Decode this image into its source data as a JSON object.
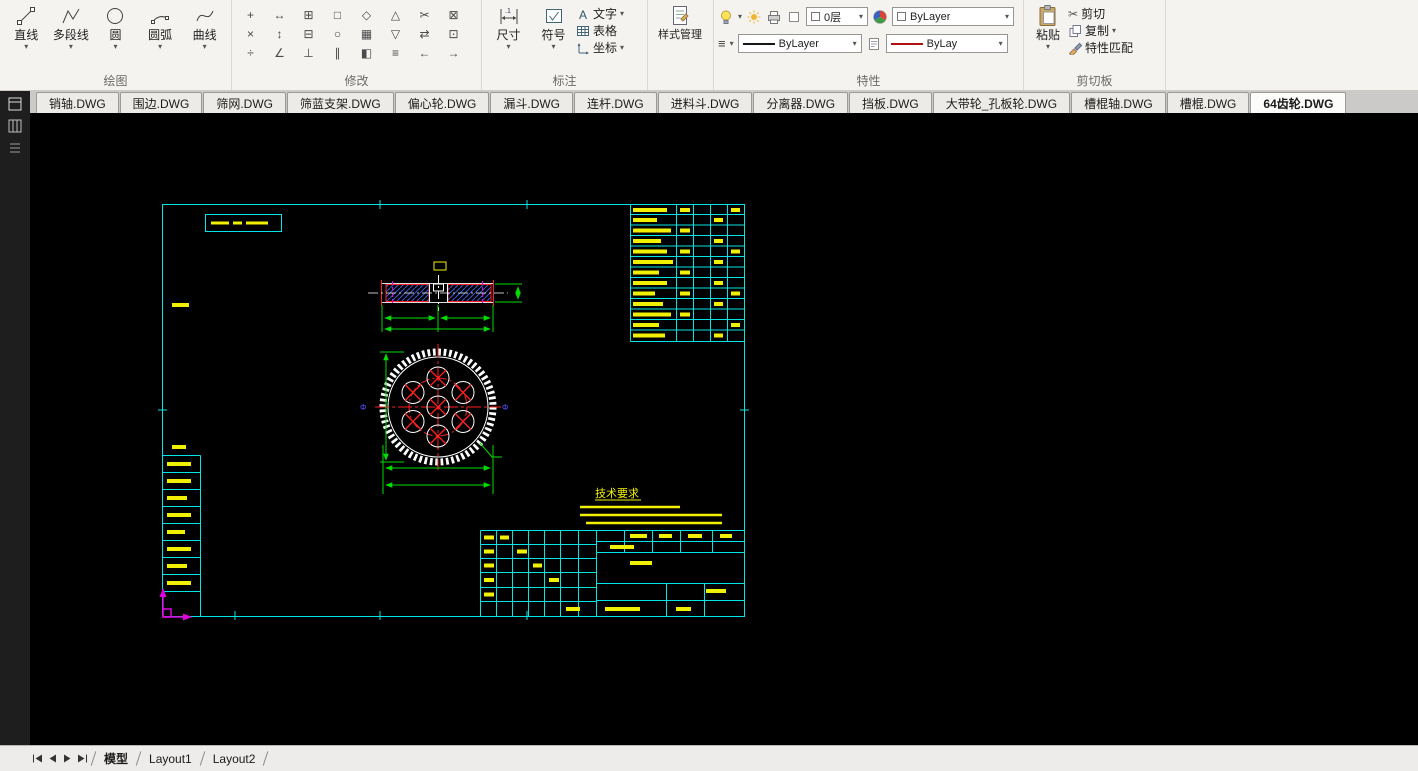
{
  "ribbon": {
    "draw": {
      "label": "绘图",
      "tools": [
        "直线",
        "多段线",
        "圆",
        "圆弧",
        "曲线"
      ]
    },
    "modify": {
      "label": "修改"
    },
    "annotate": {
      "label": "标注",
      "dimension": "尺寸",
      "symbol": "符号",
      "text": "文字",
      "table": "表格",
      "coordinate": "坐标",
      "text_icon": "A",
      "dim_icon": ".1"
    },
    "style_manager": {
      "button": "样式管理"
    },
    "properties": {
      "label": "特性",
      "layer": "0层",
      "color": "ByLayer",
      "linetype": "ByLayer",
      "lineweight": "ByLay"
    },
    "clipboard": {
      "label": "剪切板",
      "paste": "粘贴",
      "cut": "剪切",
      "copy": "复制",
      "match": "特性匹配"
    }
  },
  "file_tabs": [
    "销轴.DWG",
    "围边.DWG",
    "筛网.DWG",
    "筛蓝支架.DWG",
    "偏心轮.DWG",
    "漏斗.DWG",
    "连杆.DWG",
    "进料斗.DWG",
    "分离器.DWG",
    "挡板.DWG",
    "大带轮_孔板轮.DWG",
    "槽棍轴.DWG",
    "槽棍.DWG",
    "64齿轮.DWG"
  ],
  "active_file_tab": "64齿轮.DWG",
  "drawing": {
    "tech_req": "技术要求",
    "dia_label": "Φ"
  },
  "status": {
    "model": "模型",
    "layout1": "Layout1",
    "layout2": "Layout2"
  },
  "colors": {
    "frame_cyan": "#00e5e5",
    "entity_yellow": "#f0f000",
    "dim_green": "#00dd00",
    "center_red": "#ff2020",
    "ucs_magenta": "#e000e0",
    "hatch_blue": "#3b5bdc",
    "canvas_bg": "#000000"
  }
}
